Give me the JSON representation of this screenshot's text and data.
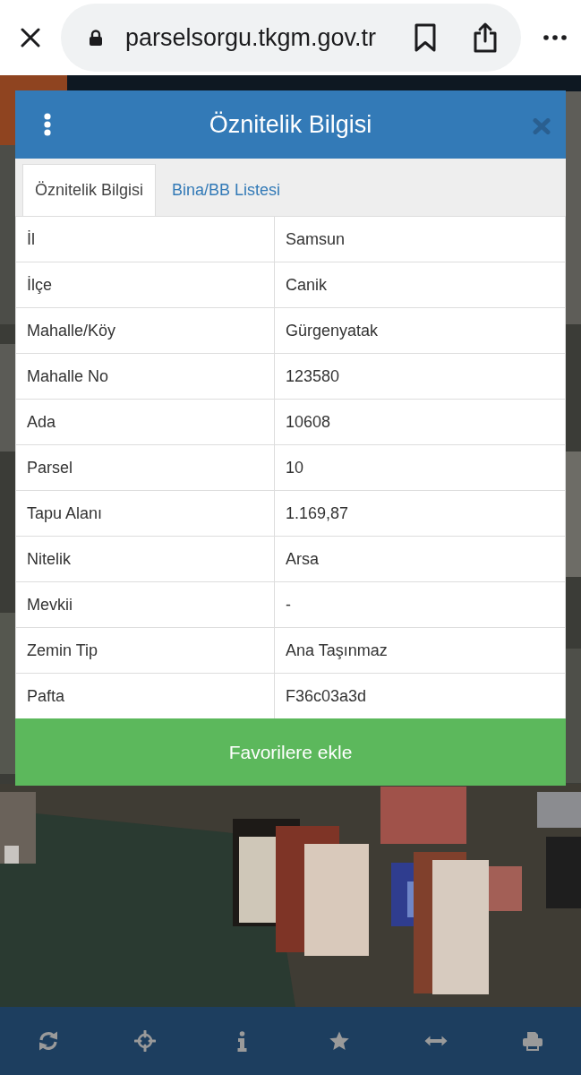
{
  "browser": {
    "url": "parselsorgu.tkgm.gov.tr"
  },
  "dialog": {
    "title": "Öznitelik Bilgisi",
    "tabs": [
      {
        "label": "Öznitelik Bilgisi",
        "selected": true
      },
      {
        "label": "Bina/BB Listesi",
        "selected": false
      }
    ],
    "rows": [
      {
        "label": "İl",
        "value": "Samsun"
      },
      {
        "label": "İlçe",
        "value": "Canik"
      },
      {
        "label": "Mahalle/Köy",
        "value": "Gürgenyatak"
      },
      {
        "label": "Mahalle No",
        "value": "123580"
      },
      {
        "label": "Ada",
        "value": "10608"
      },
      {
        "label": "Parsel",
        "value": "10"
      },
      {
        "label": "Tapu Alanı",
        "value": "1.169,87"
      },
      {
        "label": "Nitelik",
        "value": "Arsa"
      },
      {
        "label": "Mevkii",
        "value": "-"
      },
      {
        "label": "Zemin Tip",
        "value": "Ana Taşınmaz"
      },
      {
        "label": "Pafta",
        "value": "F36c03a3d"
      }
    ],
    "button": "Favorilere ekle"
  }
}
